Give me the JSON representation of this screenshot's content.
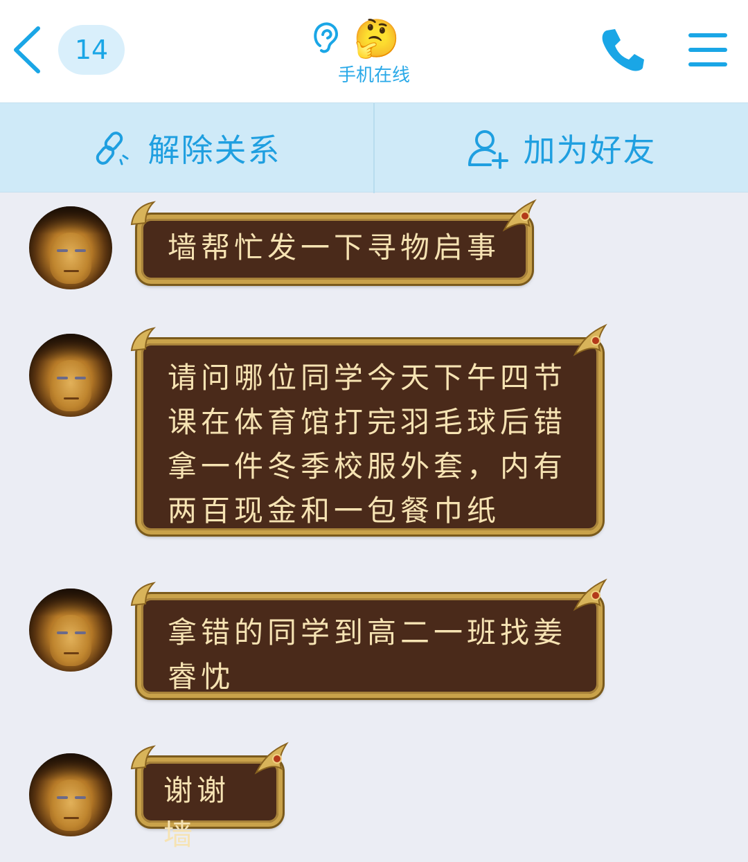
{
  "header": {
    "unread_count": "14",
    "status": "手机在线",
    "contact_avatar_emoji": "🤔"
  },
  "actions": {
    "remove_relation": "解除关系",
    "add_friend": "加为好友"
  },
  "messages": [
    {
      "text": "墙帮忙发一下寻物启事"
    },
    {
      "text": "请问哪位同学今天下午四节课在体育馆打完羽毛球后错拿一件冬季校服外套，内有两百现金和一包餐巾纸"
    },
    {
      "text": "拿错的同学到高二一班找姜睿忱"
    },
    {
      "text": "谢谢墙"
    }
  ],
  "colors": {
    "accent": "#1aa6e6",
    "bubble_bg": "#4a2a1a",
    "bubble_border": "#c9a24a",
    "bubble_text": "#f6e3b3",
    "chat_bg": "#ebedf4",
    "action_bar_bg": "#cfeaf8"
  },
  "icons": {
    "back": "chevron-left-icon",
    "listen": "ear-icon",
    "call": "phone-icon",
    "menu": "hamburger-menu-icon",
    "unlink": "broken-link-icon",
    "add_friend": "add-user-icon"
  }
}
